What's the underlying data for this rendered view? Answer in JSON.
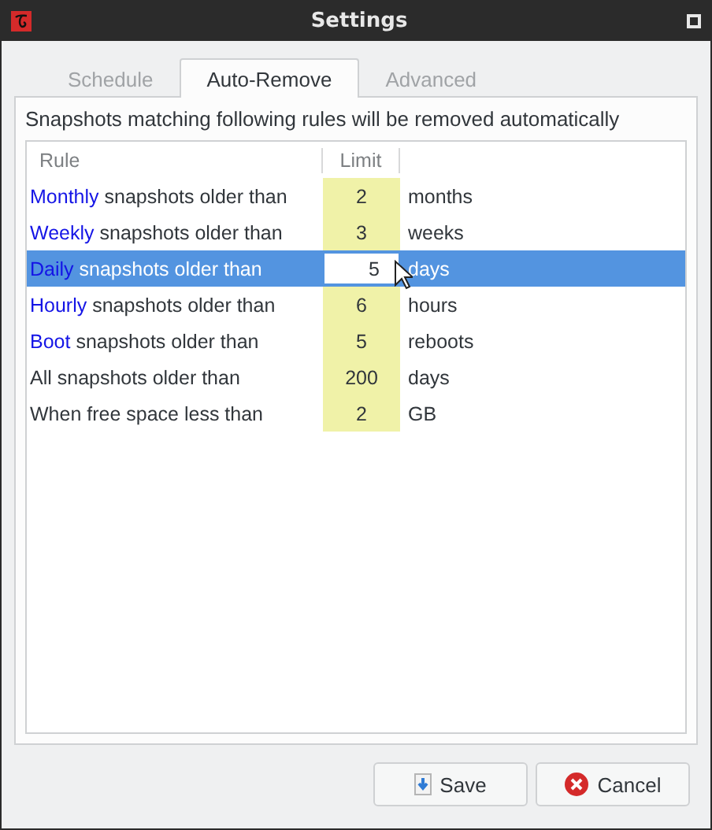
{
  "window": {
    "title": "Settings"
  },
  "tabs": [
    {
      "label": "Schedule",
      "selected": false
    },
    {
      "label": "Auto-Remove",
      "selected": true
    },
    {
      "label": "Advanced",
      "selected": false
    }
  ],
  "description": "Snapshots matching following rules will be removed automatically",
  "table": {
    "columns": [
      "Rule",
      "Limit"
    ],
    "rows": [
      {
        "highlight": "Monthly",
        "text": "snapshots older than",
        "limit": "2",
        "unit": "months",
        "selected": false,
        "editing": false
      },
      {
        "highlight": "Weekly",
        "text": "snapshots older than",
        "limit": "3",
        "unit": "weeks",
        "selected": false,
        "editing": false
      },
      {
        "highlight": "Daily",
        "text": "snapshots older than",
        "limit": "5",
        "unit": "days",
        "selected": true,
        "editing": true
      },
      {
        "highlight": "Hourly",
        "text": "snapshots older than",
        "limit": "6",
        "unit": "hours",
        "selected": false,
        "editing": false
      },
      {
        "highlight": "Boot",
        "text": "snapshots older than",
        "limit": "5",
        "unit": "reboots",
        "selected": false,
        "editing": false
      },
      {
        "text": "All snapshots older than",
        "limit": "200",
        "unit": "days",
        "selected": false,
        "editing": false
      },
      {
        "text": "When free space less than",
        "limit": "2",
        "unit": "GB",
        "selected": false,
        "editing": false
      }
    ]
  },
  "buttons": [
    {
      "kind": "save",
      "label": "Save"
    },
    {
      "kind": "cancel",
      "label": "Cancel"
    }
  ]
}
